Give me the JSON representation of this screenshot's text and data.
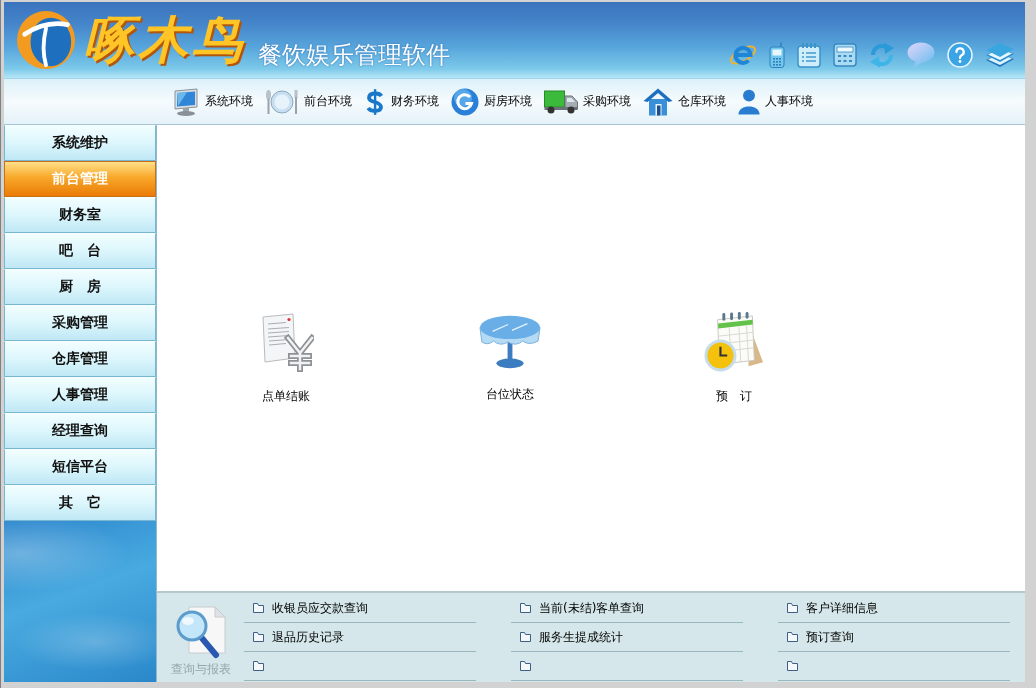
{
  "header": {
    "logo_text": "啄木鸟",
    "product_name": "餐饮娱乐管理软件"
  },
  "nav": [
    "系统环境",
    "前台环境",
    "财务环境",
    "厨房环境",
    "采购环境",
    "仓库环境",
    "人事环境"
  ],
  "sidebar": {
    "items": [
      {
        "label": "系统维护",
        "selected": false
      },
      {
        "label": "前台管理",
        "selected": true
      },
      {
        "label": "财务室",
        "selected": false
      },
      {
        "label": "吧　台",
        "selected": false
      },
      {
        "label": "厨　房",
        "selected": false
      },
      {
        "label": "采购管理",
        "selected": false
      },
      {
        "label": "仓库管理",
        "selected": false
      },
      {
        "label": "人事管理",
        "selected": false
      },
      {
        "label": "经理查询",
        "selected": false
      },
      {
        "label": "短信平台",
        "selected": false
      },
      {
        "label": "其　它",
        "selected": false
      }
    ]
  },
  "modules": [
    "点单结账",
    "台位状态",
    "预　订"
  ],
  "reports": {
    "title": "查询与报表",
    "columns": [
      {
        "rows": [
          {
            "kind": "link",
            "label": "收银员应交款查询"
          },
          {
            "kind": "link",
            "label": "退品历史记录"
          },
          {
            "kind": "blank"
          }
        ]
      },
      {
        "rows": [
          {
            "kind": "link",
            "label": "当前(未结)客单查询"
          },
          {
            "kind": "link",
            "label": "服务生提成统计"
          },
          {
            "kind": "blank"
          }
        ]
      },
      {
        "rows": [
          {
            "kind": "link",
            "label": "客户详细信息"
          },
          {
            "kind": "link",
            "label": "预订查询"
          },
          {
            "kind": "blank"
          }
        ]
      }
    ]
  }
}
